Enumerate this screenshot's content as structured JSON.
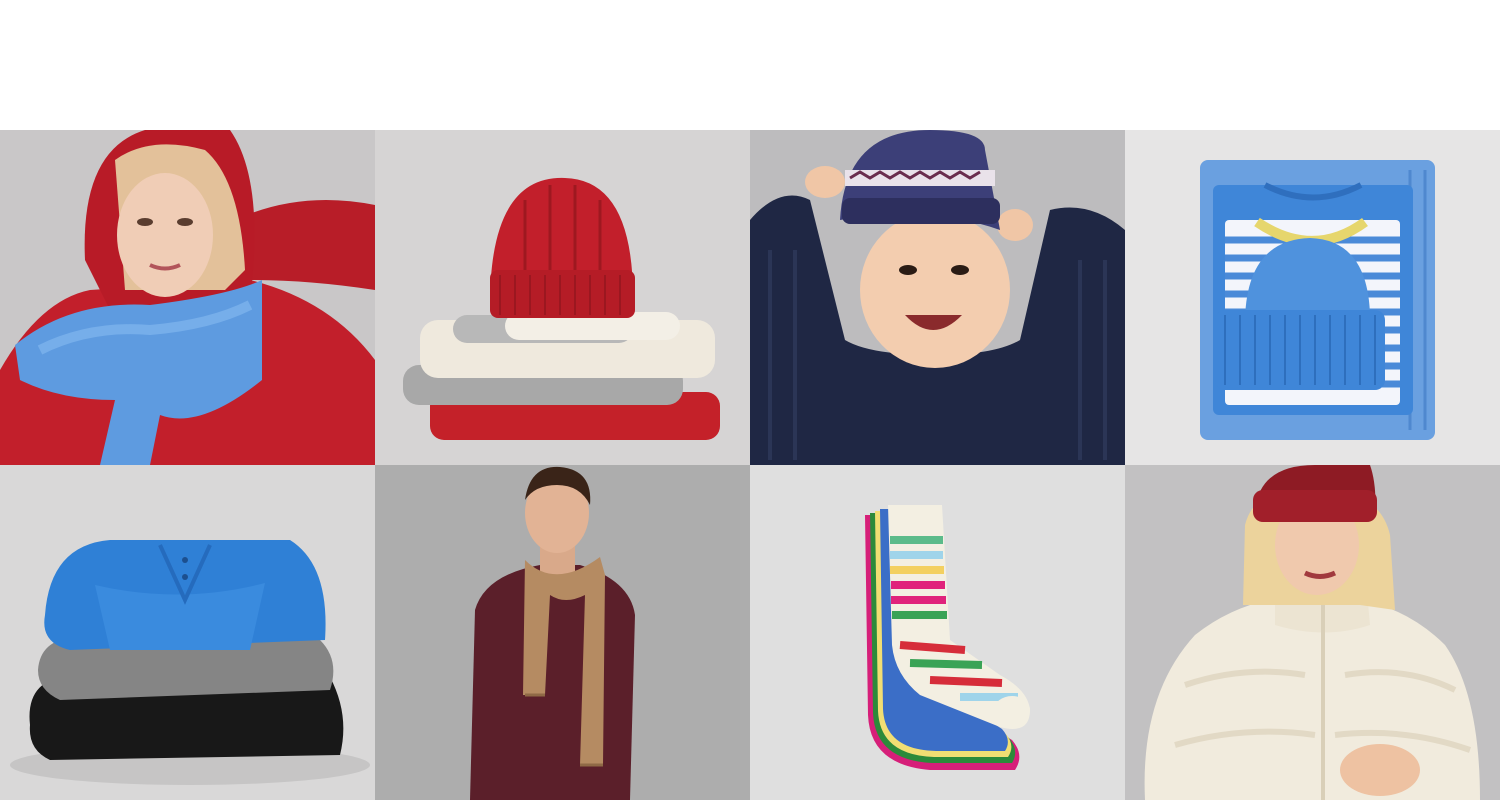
{
  "tiles": [
    {
      "name": "woman-red-hoodie-blue-scarf",
      "bg": "#c9c7c8"
    },
    {
      "name": "red-cable-beanie-stack",
      "bg": "#d6d4d4"
    },
    {
      "name": "child-navy-sweater-fairisle-hat",
      "bg": "#bdbcbe"
    },
    {
      "name": "blue-folded-stripe-knits",
      "bg": "#e6e5e5"
    },
    {
      "name": "folded-sweaters-blue-grey-black",
      "bg": "#d9d8d8"
    },
    {
      "name": "man-burgundy-sweater-camel-scarf",
      "bg": "#a9a8a9"
    },
    {
      "name": "striped-socks-stack",
      "bg": "#dfdfdf"
    },
    {
      "name": "child-sherpa-jacket-red-beanie",
      "bg": "#c2c1c2"
    }
  ],
  "colors": {
    "red": "#c21f2b",
    "blue": "#5e9be0",
    "navy": "#1f2744",
    "cream": "#efe9dd",
    "grey": "#a7a7a7",
    "burgundy": "#5b1f2a",
    "camel": "#b58b62",
    "black": "#181818",
    "royal": "#2f80d6"
  }
}
